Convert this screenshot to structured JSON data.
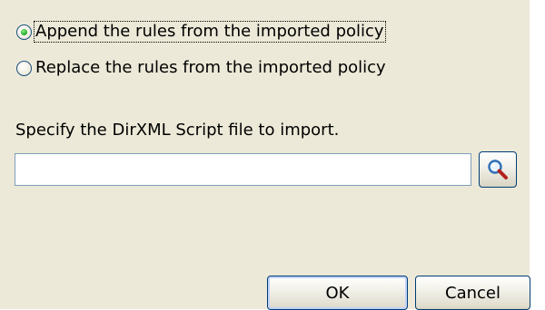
{
  "options": {
    "append_label": "Append the rules from the imported policy",
    "replace_label": "Replace the rules from the imported policy",
    "selected": "append"
  },
  "file": {
    "prompt": "Specify the DirXML Script file to import.",
    "value": "",
    "browse_icon": "magnifier-icon"
  },
  "buttons": {
    "ok_label": "OK",
    "cancel_label": "Cancel"
  },
  "colors": {
    "panel_background": "#ece9d8",
    "border_accent": "#003c74",
    "radio_selected": "#2bb33a"
  }
}
